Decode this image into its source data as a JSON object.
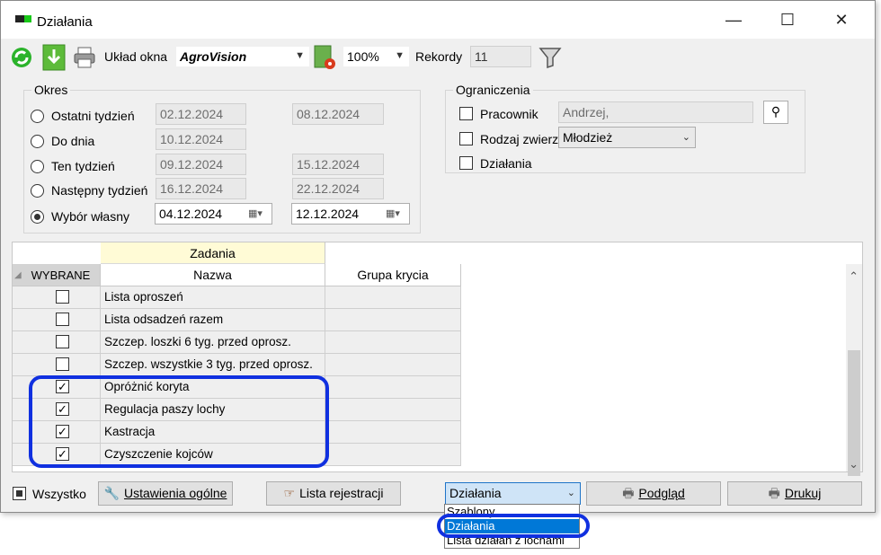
{
  "window": {
    "title": "Działania",
    "controls": {
      "minimize": "—",
      "maximize": "☐",
      "close": "✕"
    }
  },
  "toolbar": {
    "layout_label": "Układ okna",
    "layout_value": "AgroVision",
    "zoom_value": "100%",
    "records_label": "Rekordy",
    "records_value": "11",
    "icons": [
      "refresh-icon",
      "download-icon",
      "printer-icon",
      "layout-settings-icon",
      "filter-icon"
    ]
  },
  "okres": {
    "title": "Okres",
    "options": [
      {
        "label": "Ostatni tydzień",
        "from": "02.12.2024",
        "to": "08.12.2024",
        "selected": false
      },
      {
        "label": "Do dnia",
        "from": "10.12.2024",
        "to": "",
        "selected": false
      },
      {
        "label": "Ten tydzień",
        "from": "09.12.2024",
        "to": "15.12.2024",
        "selected": false
      },
      {
        "label": "Następny tydzień",
        "from": "16.12.2024",
        "to": "22.12.2024",
        "selected": false
      },
      {
        "label": "Wybór własny",
        "from": "04.12.2024",
        "to": "12.12.2024",
        "selected": true
      }
    ]
  },
  "ograniczenia": {
    "title": "Ograniczenia",
    "pracownik_label": "Pracownik",
    "pracownik_value": "Andrzej,",
    "rodzaj_label": "Rodzaj zwierzą",
    "rodzaj_value": "Młodzież",
    "dzialania_label": "Działania"
  },
  "grid": {
    "band_title": "Zadania",
    "col_selected": "WYBRANE",
    "col_name": "Nazwa",
    "col_group": "Grupa krycia",
    "rows": [
      {
        "name": "Lista oproszeń",
        "checked": false
      },
      {
        "name": "Lista odsadzeń razem",
        "checked": false
      },
      {
        "name": "Szczep. loszki 6 tyg. przed oprosz.",
        "checked": false
      },
      {
        "name": "Szczep. wszystkie 3 tyg. przed oprosz.",
        "checked": false
      },
      {
        "name": "Opróżnić koryta",
        "checked": true
      },
      {
        "name": "Regulacja paszy lochy",
        "checked": true
      },
      {
        "name": "Kastracja",
        "checked": true
      },
      {
        "name": "Czyszczenie kojców",
        "checked": true
      }
    ]
  },
  "bottom": {
    "all_label": "Wszystko",
    "settings_label": "Ustawienia ogólne",
    "registry_label": "Lista rejestracji",
    "combo_value": "Działania",
    "dropdown_options": [
      "Szablony",
      "Działania",
      "Lista działań z lochami"
    ],
    "dropdown_selected_index": 1,
    "preview_label": "Podgląd",
    "print_label": "Drukuj"
  },
  "colors": {
    "highlight_ring": "#1030e0",
    "band_header": "#fffbd6",
    "selection": "#0078d7"
  }
}
